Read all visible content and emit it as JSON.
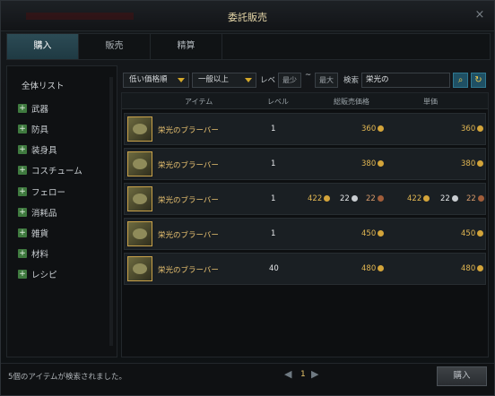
{
  "window": {
    "title": "委託販売",
    "close_icon": "close-icon"
  },
  "tabs": [
    {
      "label": "購入",
      "active": true
    },
    {
      "label": "販売",
      "active": false
    },
    {
      "label": "精算",
      "active": false
    }
  ],
  "sidebar": {
    "header": "全体リスト",
    "items": [
      {
        "label": "武器",
        "icon": "plus-icon"
      },
      {
        "label": "防具",
        "icon": "plus-icon"
      },
      {
        "label": "装身具",
        "icon": "plus-icon"
      },
      {
        "label": "コスチューム",
        "icon": "plus-icon"
      },
      {
        "label": "フェロー",
        "icon": "plus-icon"
      },
      {
        "label": "消耗品",
        "icon": "plus-icon"
      },
      {
        "label": "雑貨",
        "icon": "plus-icon"
      },
      {
        "label": "材料",
        "icon": "plus-icon"
      },
      {
        "label": "レシピ",
        "icon": "plus-icon"
      }
    ]
  },
  "filters": {
    "sort_value": "低い価格順",
    "grade_value": "一般以上",
    "level_label": "レベ",
    "level_min_placeholder": "最少",
    "level_separator": "~",
    "level_max_placeholder": "最大",
    "search_label": "検索",
    "search_value": "栄光の",
    "search_icon": "search-icon",
    "refresh_icon": "refresh-icon"
  },
  "table": {
    "columns": {
      "item": "アイテム",
      "level": "レベル",
      "total": "総販売価格",
      "unit": "単価"
    },
    "rows": [
      {
        "name": "栄光のブラーバー",
        "level": "1",
        "total_gold": "360",
        "unit_gold": "360"
      },
      {
        "name": "栄光のブラーバー",
        "level": "1",
        "total_gold": "380",
        "unit_gold": "380"
      },
      {
        "name": "栄光のブラーバー",
        "level": "1",
        "total_gold": "422",
        "total_silver": "22",
        "total_copper": "22",
        "unit_gold": "422",
        "unit_silver": "22",
        "unit_copper": "22"
      },
      {
        "name": "栄光のブラーバー",
        "level": "1",
        "total_gold": "450",
        "unit_gold": "450"
      },
      {
        "name": "栄光のブラーバー",
        "level": "40",
        "total_gold": "480",
        "unit_gold": "480"
      }
    ]
  },
  "footer": {
    "status": "5個のアイテムが検索されました。",
    "page": "1",
    "buy_label": "購入"
  },
  "colors": {
    "accent_tab": "#2c4b55",
    "gold": "#d3a43a",
    "item_name": "#e8c170"
  }
}
